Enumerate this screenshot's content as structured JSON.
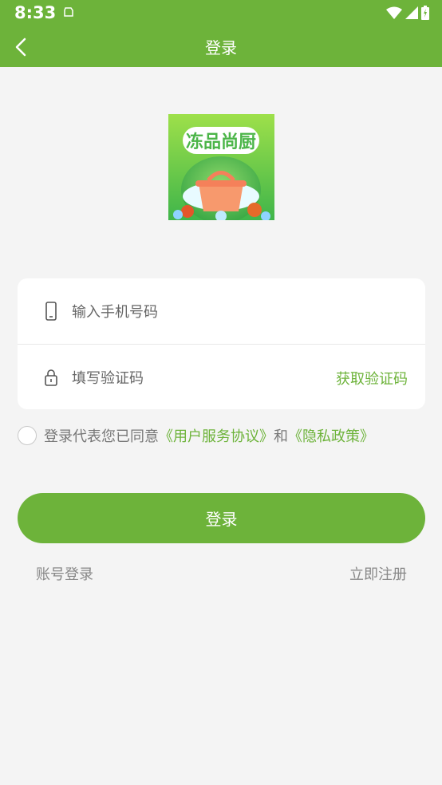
{
  "status_bar": {
    "time": "8:33"
  },
  "app_bar": {
    "title": "登录"
  },
  "logo": {
    "text": "冻品尚厨"
  },
  "form": {
    "phone_placeholder": "输入手机号码",
    "code_placeholder": "填写验证码",
    "get_code_label": "获取验证码"
  },
  "agreement": {
    "prefix": "登录代表您已同意",
    "user_agreement": "《用户服务协议》",
    "conjunction": "和",
    "privacy_policy": "《隐私政策》"
  },
  "login_button": "登录",
  "links": {
    "account_login": "账号登录",
    "register": "立即注册"
  },
  "colors": {
    "brand_green": "#6db33a",
    "background": "#f4f4f4"
  }
}
